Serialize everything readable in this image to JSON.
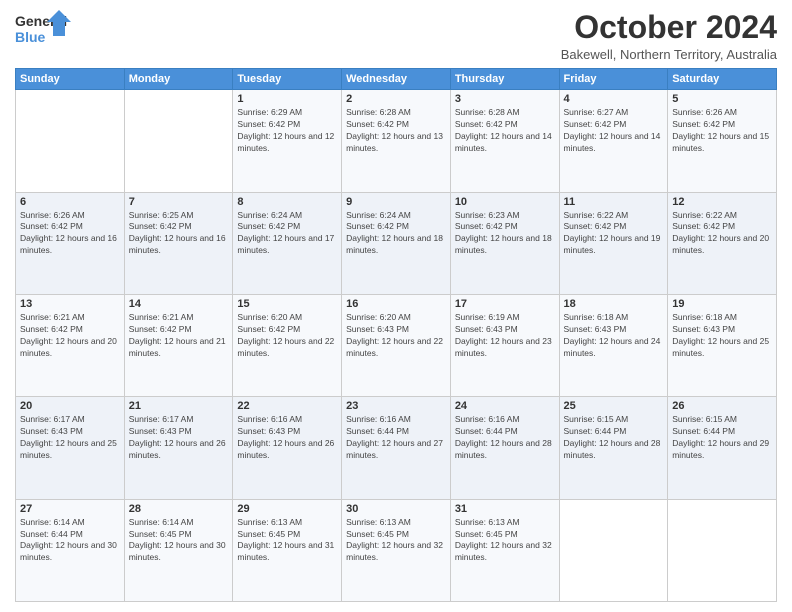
{
  "header": {
    "logo_general": "General",
    "logo_blue": "Blue",
    "month": "October 2024",
    "location": "Bakewell, Northern Territory, Australia"
  },
  "weekdays": [
    "Sunday",
    "Monday",
    "Tuesday",
    "Wednesday",
    "Thursday",
    "Friday",
    "Saturday"
  ],
  "weeks": [
    [
      {
        "day": "",
        "detail": ""
      },
      {
        "day": "",
        "detail": ""
      },
      {
        "day": "1",
        "detail": "Sunrise: 6:29 AM\nSunset: 6:42 PM\nDaylight: 12 hours and 12 minutes."
      },
      {
        "day": "2",
        "detail": "Sunrise: 6:28 AM\nSunset: 6:42 PM\nDaylight: 12 hours and 13 minutes."
      },
      {
        "day": "3",
        "detail": "Sunrise: 6:28 AM\nSunset: 6:42 PM\nDaylight: 12 hours and 14 minutes."
      },
      {
        "day": "4",
        "detail": "Sunrise: 6:27 AM\nSunset: 6:42 PM\nDaylight: 12 hours and 14 minutes."
      },
      {
        "day": "5",
        "detail": "Sunrise: 6:26 AM\nSunset: 6:42 PM\nDaylight: 12 hours and 15 minutes."
      }
    ],
    [
      {
        "day": "6",
        "detail": "Sunrise: 6:26 AM\nSunset: 6:42 PM\nDaylight: 12 hours and 16 minutes."
      },
      {
        "day": "7",
        "detail": "Sunrise: 6:25 AM\nSunset: 6:42 PM\nDaylight: 12 hours and 16 minutes."
      },
      {
        "day": "8",
        "detail": "Sunrise: 6:24 AM\nSunset: 6:42 PM\nDaylight: 12 hours and 17 minutes."
      },
      {
        "day": "9",
        "detail": "Sunrise: 6:24 AM\nSunset: 6:42 PM\nDaylight: 12 hours and 18 minutes."
      },
      {
        "day": "10",
        "detail": "Sunrise: 6:23 AM\nSunset: 6:42 PM\nDaylight: 12 hours and 18 minutes."
      },
      {
        "day": "11",
        "detail": "Sunrise: 6:22 AM\nSunset: 6:42 PM\nDaylight: 12 hours and 19 minutes."
      },
      {
        "day": "12",
        "detail": "Sunrise: 6:22 AM\nSunset: 6:42 PM\nDaylight: 12 hours and 20 minutes."
      }
    ],
    [
      {
        "day": "13",
        "detail": "Sunrise: 6:21 AM\nSunset: 6:42 PM\nDaylight: 12 hours and 20 minutes."
      },
      {
        "day": "14",
        "detail": "Sunrise: 6:21 AM\nSunset: 6:42 PM\nDaylight: 12 hours and 21 minutes."
      },
      {
        "day": "15",
        "detail": "Sunrise: 6:20 AM\nSunset: 6:42 PM\nDaylight: 12 hours and 22 minutes."
      },
      {
        "day": "16",
        "detail": "Sunrise: 6:20 AM\nSunset: 6:43 PM\nDaylight: 12 hours and 22 minutes."
      },
      {
        "day": "17",
        "detail": "Sunrise: 6:19 AM\nSunset: 6:43 PM\nDaylight: 12 hours and 23 minutes."
      },
      {
        "day": "18",
        "detail": "Sunrise: 6:18 AM\nSunset: 6:43 PM\nDaylight: 12 hours and 24 minutes."
      },
      {
        "day": "19",
        "detail": "Sunrise: 6:18 AM\nSunset: 6:43 PM\nDaylight: 12 hours and 25 minutes."
      }
    ],
    [
      {
        "day": "20",
        "detail": "Sunrise: 6:17 AM\nSunset: 6:43 PM\nDaylight: 12 hours and 25 minutes."
      },
      {
        "day": "21",
        "detail": "Sunrise: 6:17 AM\nSunset: 6:43 PM\nDaylight: 12 hours and 26 minutes."
      },
      {
        "day": "22",
        "detail": "Sunrise: 6:16 AM\nSunset: 6:43 PM\nDaylight: 12 hours and 26 minutes."
      },
      {
        "day": "23",
        "detail": "Sunrise: 6:16 AM\nSunset: 6:44 PM\nDaylight: 12 hours and 27 minutes."
      },
      {
        "day": "24",
        "detail": "Sunrise: 6:16 AM\nSunset: 6:44 PM\nDaylight: 12 hours and 28 minutes."
      },
      {
        "day": "25",
        "detail": "Sunrise: 6:15 AM\nSunset: 6:44 PM\nDaylight: 12 hours and 28 minutes."
      },
      {
        "day": "26",
        "detail": "Sunrise: 6:15 AM\nSunset: 6:44 PM\nDaylight: 12 hours and 29 minutes."
      }
    ],
    [
      {
        "day": "27",
        "detail": "Sunrise: 6:14 AM\nSunset: 6:44 PM\nDaylight: 12 hours and 30 minutes."
      },
      {
        "day": "28",
        "detail": "Sunrise: 6:14 AM\nSunset: 6:45 PM\nDaylight: 12 hours and 30 minutes."
      },
      {
        "day": "29",
        "detail": "Sunrise: 6:13 AM\nSunset: 6:45 PM\nDaylight: 12 hours and 31 minutes."
      },
      {
        "day": "30",
        "detail": "Sunrise: 6:13 AM\nSunset: 6:45 PM\nDaylight: 12 hours and 32 minutes."
      },
      {
        "day": "31",
        "detail": "Sunrise: 6:13 AM\nSunset: 6:45 PM\nDaylight: 12 hours and 32 minutes."
      },
      {
        "day": "",
        "detail": ""
      },
      {
        "day": "",
        "detail": ""
      }
    ]
  ]
}
